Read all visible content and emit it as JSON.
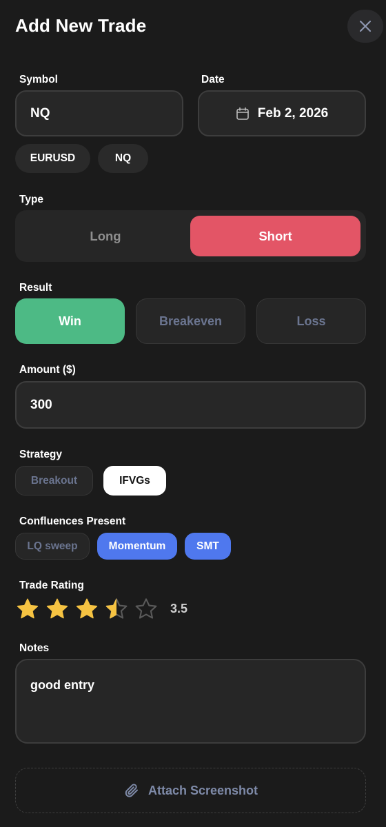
{
  "header": {
    "title": "Add New Trade"
  },
  "symbol": {
    "label": "Symbol",
    "value": "NQ",
    "recent": [
      "EURUSD",
      "NQ"
    ]
  },
  "date": {
    "label": "Date",
    "value": "Feb 2, 2026"
  },
  "type": {
    "label": "Type",
    "options": [
      "Long",
      "Short"
    ],
    "selected": "Short"
  },
  "result": {
    "label": "Result",
    "options": [
      "Win",
      "Breakeven",
      "Loss"
    ],
    "selected": "Win"
  },
  "amount": {
    "label": "Amount ($)",
    "value": "300"
  },
  "strategy": {
    "label": "Strategy",
    "options": [
      "Breakout",
      "IFVGs"
    ],
    "selected": "IFVGs"
  },
  "confluences": {
    "label": "Confluences Present",
    "options": [
      "LQ sweep",
      "Momentum",
      "SMT"
    ],
    "selected": [
      "Momentum",
      "SMT"
    ]
  },
  "rating": {
    "label": "Trade Rating",
    "value": "3.5",
    "stars": 5,
    "filled": 3.5
  },
  "notes": {
    "label": "Notes",
    "value": "good entry"
  },
  "attach": {
    "label": "Attach Screenshot"
  },
  "colors": {
    "background": "#1b1b1b",
    "short_active": "#e35566",
    "win_active": "#4dba85",
    "confluence_active": "#4f78ee",
    "strategy_active": "#ffffff",
    "star_filled": "#f6c342",
    "muted_text": "#6b7590"
  },
  "icons": {
    "close": "close-icon",
    "date": "calendar-icon",
    "attach": "paperclip-icon",
    "rating": "star-icon"
  }
}
